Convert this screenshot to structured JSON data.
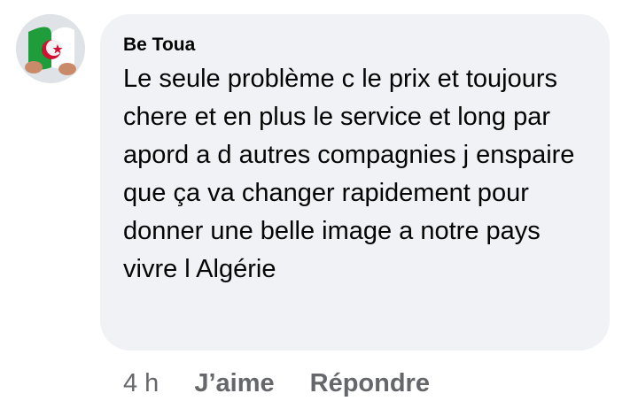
{
  "comment": {
    "author": "Be Toua",
    "text": "Le seule problème c le prix et toujours chere et en plus le service et long par apord a d autres compagnies j enspaire que ça va changer rapidement pour donner une belle image a notre pays vivre l Algérie",
    "avatar_icon": "avatar-flag-icon"
  },
  "actions": {
    "time": "4 h",
    "like_label": "J’aime",
    "reply_label": "Répondre"
  },
  "colors": {
    "bubble_bg": "#f0f2f5",
    "text": "#050505",
    "meta": "#65676b",
    "flag_green": "#1f9d3a",
    "flag_red": "#d21034"
  }
}
